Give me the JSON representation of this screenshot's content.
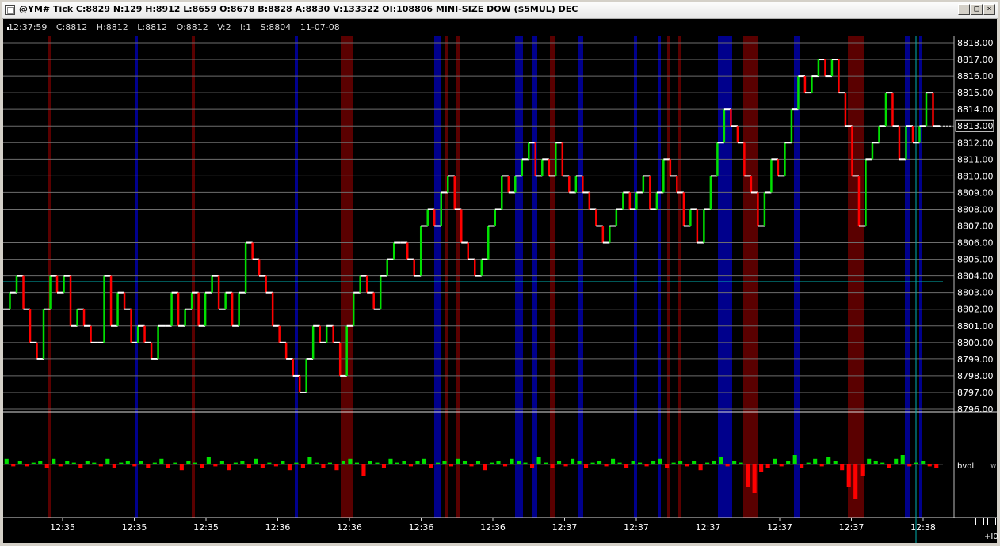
{
  "window": {
    "title": "@YM# Tick C:8829 N:129 H:8912 L:8659 O:8678 B:8828 A:8830 V:133322 OI:108806 MINI-SIZE DOW ($5MUL) DEC",
    "btn_minimize": "_",
    "btn_maximize": "□",
    "btn_close": "×"
  },
  "info": {
    "time": "12:37:59",
    "close": "C:8812",
    "high": "H:8812",
    "low": "L:8812",
    "open": "O:8812",
    "volume": "V:2",
    "index": "I:1",
    "s": "S:8804",
    "date": "11-07-08"
  },
  "panel": {
    "bvol_label": "bvol",
    "w_label": "w",
    "plus_label": "+I0"
  },
  "colors": {
    "up": "#00e000",
    "down": "#ff0000",
    "band_blue": "#00008c",
    "band_red": "#5a0000",
    "grid": "#6e6e6e",
    "cursor": "#00b0b0",
    "price_box": "#ffffff"
  },
  "chart_data": {
    "type": "line",
    "title": "",
    "ylim": [
      8796,
      8818
    ],
    "yticks": [
      "8818.00",
      "8817.00",
      "8816.00",
      "8815.00",
      "8814.00",
      "8813.00",
      "8812.00",
      "8811.00",
      "8810.00",
      "8809.00",
      "8808.00",
      "8807.00",
      "8806.00",
      "8805.00",
      "8804.00",
      "8803.00",
      "8802.00",
      "8801.00",
      "8800.00",
      "8799.00",
      "8798.00",
      "8797.00",
      "8796.00"
    ],
    "last_price": "8813.00",
    "xticks": [
      "12:35",
      "12:35",
      "12:35",
      "12:36",
      "12:36",
      "12:36",
      "12:36",
      "12:37",
      "12:37",
      "12:37",
      "12:37",
      "12:37",
      "12:38"
    ],
    "price_series": [
      8802,
      8803,
      8804,
      8802,
      8800,
      8799,
      8802,
      8804,
      8803,
      8804,
      8801,
      8802,
      8801,
      8800,
      8800,
      8804,
      8801,
      8803,
      8802,
      8800,
      8801,
      8800,
      8799,
      8801,
      8801,
      8803,
      8801,
      8802,
      8803,
      8801,
      8803,
      8804,
      8802,
      8803,
      8801,
      8803,
      8806,
      8805,
      8804,
      8803,
      8801,
      8800,
      8799,
      8798,
      8797,
      8799,
      8801,
      8800,
      8801,
      8800,
      8798,
      8801,
      8803,
      8804,
      8803,
      8802,
      8804,
      8805,
      8806,
      8806,
      8805,
      8804,
      8807,
      8808,
      8807,
      8809,
      8810,
      8808,
      8806,
      8805,
      8804,
      8805,
      8807,
      8808,
      8810,
      8809,
      8810,
      8811,
      8812,
      8810,
      8811,
      8810,
      8812,
      8810,
      8809,
      8810,
      8809,
      8808,
      8807,
      8806,
      8807,
      8808,
      8809,
      8808,
      8809,
      8810,
      8808,
      8809,
      8811,
      8810,
      8809,
      8807,
      8808,
      8806,
      8808,
      8810,
      8812,
      8814,
      8813,
      8812,
      8810,
      8809,
      8807,
      8809,
      8811,
      8810,
      8812,
      8814,
      8816,
      8815,
      8816,
      8817,
      8816,
      8817,
      8815,
      8813,
      8810,
      8807,
      8811,
      8812,
      8813,
      8815,
      8813,
      8811,
      8813,
      8812,
      8813,
      8815,
      8813
    ],
    "volume_series": [
      3,
      -1,
      2,
      -1,
      1,
      2,
      -2,
      3,
      -1,
      2,
      1,
      -2,
      2,
      1,
      -1,
      3,
      -2,
      1,
      2,
      -1,
      2,
      -2,
      1,
      3,
      -2,
      1,
      -3,
      2,
      1,
      -2,
      4,
      -1,
      2,
      -3,
      1,
      2,
      -2,
      3,
      -2,
      1,
      -1,
      2,
      -3,
      1,
      -2,
      4,
      1,
      -2,
      1,
      -3,
      2,
      3,
      1,
      -6,
      2,
      1,
      -2,
      3,
      1,
      2,
      -1,
      2,
      3,
      -2,
      1,
      2,
      -1,
      3,
      2,
      -1,
      2,
      -3,
      1,
      2,
      -1,
      3,
      2,
      1,
      -2,
      4,
      1,
      -2,
      2,
      -1,
      3,
      2,
      -2,
      1,
      2,
      -1,
      3,
      1,
      -2,
      2,
      1,
      -1,
      2,
      3,
      -2,
      1,
      2,
      -1,
      2,
      -3,
      1,
      2,
      4,
      -1,
      2,
      1,
      -12,
      -15,
      -4,
      -2,
      3,
      -1,
      2,
      5,
      -2,
      1,
      3,
      -1,
      4,
      2,
      -3,
      -12,
      -18,
      -6,
      3,
      2,
      1,
      -2,
      3,
      5,
      -1,
      1,
      2,
      -1,
      -2
    ],
    "bands_blue": [
      [
        170,
        174
      ],
      [
        372,
        376
      ],
      [
        548,
        556
      ],
      [
        650,
        660
      ],
      [
        672,
        678
      ],
      [
        730,
        736
      ],
      [
        800,
        804
      ],
      [
        830,
        834
      ],
      [
        906,
        924
      ],
      [
        1002,
        1010
      ],
      [
        1142,
        1148
      ],
      [
        1160,
        1164
      ]
    ],
    "bands_red": [
      [
        60,
        64
      ],
      [
        242,
        246
      ],
      [
        430,
        446
      ],
      [
        562,
        566
      ],
      [
        576,
        580
      ],
      [
        694,
        700
      ],
      [
        842,
        846
      ],
      [
        856,
        860
      ],
      [
        938,
        956
      ],
      [
        1070,
        1090
      ]
    ]
  }
}
